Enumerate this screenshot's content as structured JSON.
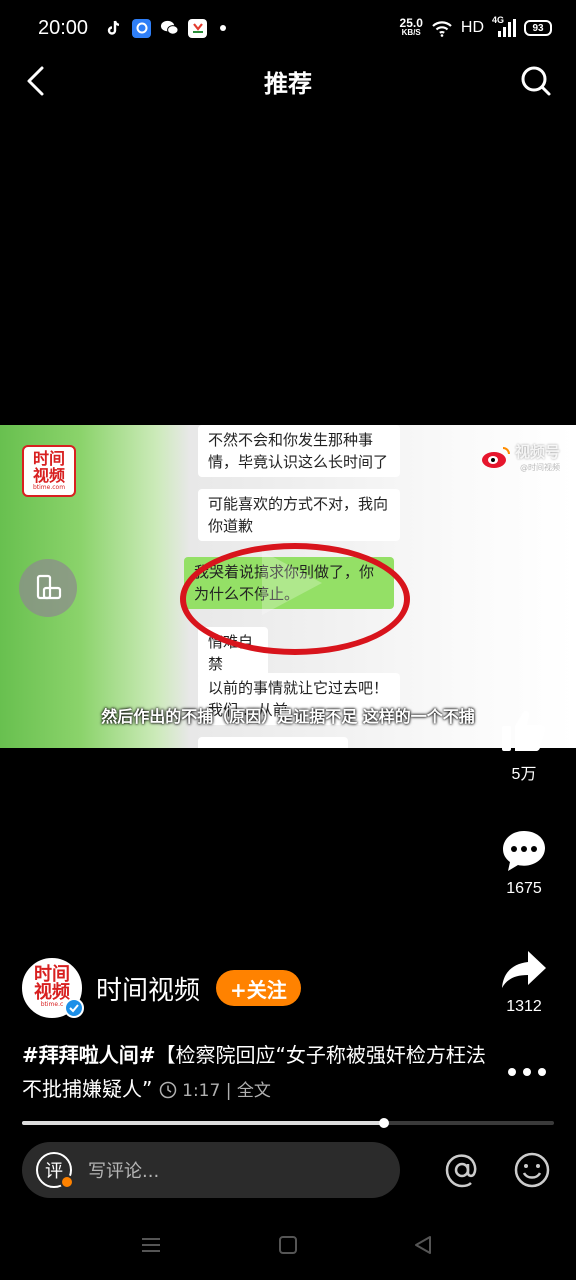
{
  "status": {
    "time": "20:00",
    "net_speed_value": "25.0",
    "net_speed_unit": "KB/S",
    "network": "HD",
    "signal": "4G",
    "battery": "93"
  },
  "header": {
    "title": "推荐"
  },
  "video": {
    "chat": {
      "msg1": "不然不会和你发生那种事情，毕竟认识这么长时间了",
      "msg2": "可能喜欢的方式不对，我向你道歉",
      "msg3": "我哭着说搞求你别做了，你为什么不停止。",
      "msg4": "情难自禁",
      "msg5": "以前的事情就让它过去吧！我们… 从前… ",
      "msg6": "… … …"
    },
    "brand_logo": {
      "line1": "时间",
      "line2": "视频",
      "small": "btime.com"
    },
    "watermark": {
      "title": "视频号",
      "sub": "@时间视频"
    },
    "subtitle": "然后作出的不捕（原因）是证据不足 这样的一个不捕"
  },
  "actions": {
    "likes": "5万",
    "comments": "1675",
    "shares": "1312"
  },
  "author": {
    "name": "时间视频",
    "follow_label": "+关注",
    "avatar_line1": "时间",
    "avatar_line2": "视频",
    "avatar_small": "btime.c"
  },
  "caption": {
    "tag": "#拜拜啦人间#",
    "text": "【检察院回应“女子称被强奸检方枉法不批捕嫌疑人”",
    "duration": "1:17",
    "full_text": "全文"
  },
  "progress": {
    "fraction": 0.68
  },
  "comment": {
    "icon_label": "评",
    "placeholder": "写评论..."
  },
  "colors": {
    "accent": "#ff8200",
    "verified": "#1c8fe8",
    "highlight_oval": "#d8141c"
  },
  "icons": [
    "back-icon",
    "search-icon",
    "rotate-screen-icon",
    "like-icon",
    "comment-icon",
    "share-icon",
    "more-icon",
    "at-icon",
    "emoji-icon",
    "menu-icon",
    "home-icon",
    "back-nav-icon"
  ]
}
